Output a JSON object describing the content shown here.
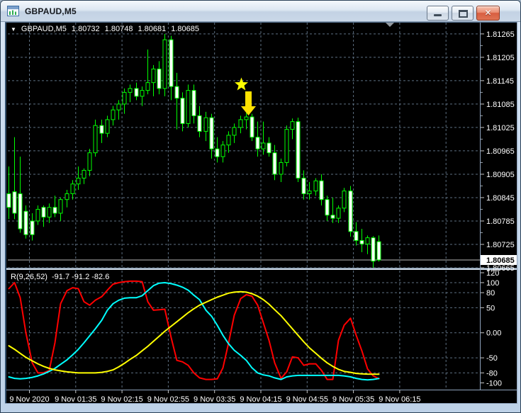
{
  "window": {
    "title": "GBPAUD,M5"
  },
  "icons": {
    "symbol_dropdown": "▼",
    "close": "✕"
  },
  "main_chart": {
    "header": {
      "symbol": "GBPAUD,M5",
      "open": "1.80732",
      "high": "1.80748",
      "low": "1.80681",
      "close": "1.80685"
    }
  },
  "indicator": {
    "label": "R(9,26,52)",
    "current_values": "-91.7 -91.2 -82.6"
  },
  "price_axis": {
    "tick_labels": [
      "1.81265",
      "1.81205",
      "1.81145",
      "1.81085",
      "1.81025",
      "1.80965",
      "1.80905",
      "1.80845",
      "1.80785",
      "1.80725",
      "1.80665"
    ],
    "current_price": "1.80685"
  },
  "time_axis": {
    "labels": [
      "9 Nov 2020",
      "9 Nov 01:35",
      "9 Nov 02:15",
      "9 Nov 02:55",
      "9 Nov 03:35",
      "9 Nov 04:15",
      "9 Nov 04:55",
      "9 Nov 05:35",
      "9 Nov 06:15"
    ]
  },
  "colors": {
    "background": "#000000",
    "grid": "#5e7082",
    "axis_text": "#ffffff",
    "tick": "#c8c8c8",
    "candle_outline": "#00ff00",
    "bull_fill": "#000000",
    "bear_fill": "#ffffff",
    "bid_line": "#b8b8b8",
    "price_tag_bg": "#ffffff",
    "price_tag_text": "#000000",
    "star": "#ffff00",
    "arrow": "#ffe100",
    "shift_marker": "#939aa1",
    "separator": "#c2cedb",
    "frame_dark": "#33516f",
    "frame_light": "#8fa3bc"
  },
  "chart_data": [
    {
      "type": "candlestick",
      "symbol": "GBPAUD",
      "period": "M5",
      "ylim": [
        1.81292,
        1.80665
      ],
      "y_ticks": [
        1.81265,
        1.81205,
        1.81145,
        1.81085,
        1.81025,
        1.80965,
        1.80905,
        1.80845,
        1.80785,
        1.80725,
        1.80665
      ],
      "current_price": 1.80685,
      "marker": {
        "type": "star-and-down-arrow",
        "candle_index": 40,
        "star_price": 1.81135
      },
      "candles": [
        [
          1.80855,
          1.80925,
          1.8079,
          1.8082
        ],
        [
          1.8086,
          1.81,
          1.8079,
          1.80805
        ],
        [
          1.80855,
          1.8095,
          1.80755,
          1.80765
        ],
        [
          1.8081,
          1.80825,
          1.8074,
          1.8075
        ],
        [
          1.80785,
          1.80805,
          1.80735,
          1.8075
        ],
        [
          1.80785,
          1.80825,
          1.80775,
          1.80815
        ],
        [
          1.8082,
          1.80825,
          1.8077,
          1.80795
        ],
        [
          1.80795,
          1.8083,
          1.8078,
          1.8082
        ],
        [
          1.8082,
          1.8085,
          1.80795,
          1.80805
        ],
        [
          1.80805,
          1.80845,
          1.80785,
          1.8084
        ],
        [
          1.8084,
          1.80865,
          1.8082,
          1.80855
        ],
        [
          1.80855,
          1.8089,
          1.8084,
          1.8088
        ],
        [
          1.8088,
          1.80925,
          1.80865,
          1.80895
        ],
        [
          1.80895,
          1.8092,
          1.8088,
          1.80915
        ],
        [
          1.80915,
          1.8097,
          1.809,
          1.8096
        ],
        [
          1.8096,
          1.81045,
          1.8095,
          1.8103
        ],
        [
          1.8103,
          1.81045,
          1.80985,
          1.8101
        ],
        [
          1.8101,
          1.81055,
          1.81,
          1.81045
        ],
        [
          1.81045,
          1.8108,
          1.8103,
          1.8107
        ],
        [
          1.8107,
          1.81095,
          1.81045,
          1.81085
        ],
        [
          1.81085,
          1.81125,
          1.8106,
          1.81115
        ],
        [
          1.81115,
          1.81135,
          1.8109,
          1.81125
        ],
        [
          1.81125,
          1.8114,
          1.81095,
          1.81105
        ],
        [
          1.81105,
          1.8113,
          1.8108,
          1.8112
        ],
        [
          1.8112,
          1.81225,
          1.8111,
          1.8114
        ],
        [
          1.8114,
          1.81185,
          1.81105,
          1.81175
        ],
        [
          1.81175,
          1.81195,
          1.8111,
          1.81125
        ],
        [
          1.81125,
          1.81265,
          1.81105,
          1.8125
        ],
        [
          1.8125,
          1.8126,
          1.81095,
          1.8113
        ],
        [
          1.8113,
          1.81165,
          1.8102,
          1.811
        ],
        [
          1.811,
          1.81115,
          1.81015,
          1.81035
        ],
        [
          1.81035,
          1.81135,
          1.81025,
          1.8112
        ],
        [
          1.8112,
          1.81135,
          1.81035,
          1.81055
        ],
        [
          1.81055,
          1.8108,
          1.81,
          1.81015
        ],
        [
          1.81015,
          1.81065,
          1.8099,
          1.8105
        ],
        [
          1.8105,
          1.8106,
          1.80945,
          1.8097
        ],
        [
          1.8097,
          1.81,
          1.80935,
          1.8095
        ],
        [
          1.8095,
          1.8099,
          1.80935,
          1.8098
        ],
        [
          1.8098,
          1.81015,
          1.8096,
          1.81005
        ],
        [
          1.81005,
          1.81035,
          1.80985,
          1.81025
        ],
        [
          1.81025,
          1.81055,
          1.8101,
          1.81045
        ],
        [
          1.81045,
          1.81062,
          1.8102,
          1.81052
        ],
        [
          1.81052,
          1.8106,
          1.8099,
          1.81
        ],
        [
          1.81,
          1.8104,
          1.8095,
          1.8097
        ],
        [
          1.8097,
          1.8104,
          1.80955,
          1.80985
        ],
        [
          1.80985,
          1.81,
          1.8095,
          1.8096
        ],
        [
          1.8096,
          1.8098,
          1.8089,
          1.80905
        ],
        [
          1.80905,
          1.80945,
          1.80885,
          1.80935
        ],
        [
          1.80935,
          1.8103,
          1.80925,
          1.8102
        ],
        [
          1.8102,
          1.81048,
          1.80995,
          1.8104
        ],
        [
          1.8104,
          1.8105,
          1.80885,
          1.80895
        ],
        [
          1.80895,
          1.80915,
          1.8084,
          1.80855
        ],
        [
          1.80855,
          1.80885,
          1.8084,
          1.80862
        ],
        [
          1.80862,
          1.80895,
          1.8085,
          1.80888
        ],
        [
          1.80888,
          1.80905,
          1.80825,
          1.8084
        ],
        [
          1.8084,
          1.8085,
          1.80785,
          1.808
        ],
        [
          1.808,
          1.80845,
          1.8078,
          1.80792
        ],
        [
          1.80792,
          1.80825,
          1.8078,
          1.80818
        ],
        [
          1.80818,
          1.8087,
          1.80808,
          1.80862
        ],
        [
          1.80862,
          1.80875,
          1.80745,
          1.80758
        ],
        [
          1.80758,
          1.80782,
          1.80722,
          1.80735
        ],
        [
          1.80735,
          1.80765,
          1.80705,
          1.80726
        ],
        [
          1.80726,
          1.80748,
          1.807,
          1.80742
        ],
        [
          1.80742,
          1.80746,
          1.80665,
          1.80682
        ],
        [
          1.80732,
          1.80748,
          1.80681,
          1.80685
        ]
      ]
    },
    {
      "type": "line",
      "name": "R(9,26,52)",
      "ylim": [
        124,
        -112
      ],
      "levels": [
        100,
        80,
        50,
        0,
        -50,
        -80
      ],
      "scale_labels": [
        "120",
        "100",
        "80",
        "50",
        "0.00",
        "-50",
        "-80",
        "-100"
      ],
      "scale_values": [
        120,
        100,
        80,
        50,
        0,
        -50,
        -80,
        -100
      ],
      "series": [
        {
          "name": "R9",
          "color": "#ff0000",
          "values": [
            88,
            100,
            70,
            0,
            -60,
            -80,
            -80,
            -75,
            -20,
            58,
            84,
            90,
            88,
            62,
            55,
            65,
            72,
            85,
            97,
            100,
            102,
            103,
            103,
            102,
            62,
            45,
            46,
            47,
            -10,
            -55,
            -58,
            -65,
            -80,
            -90,
            -93,
            -93,
            -92,
            -70,
            -20,
            35,
            68,
            76,
            73,
            55,
            20,
            -15,
            -60,
            -91,
            -78,
            -48,
            -50,
            -65,
            -62,
            -62,
            -75,
            -93,
            -93,
            -15,
            15,
            29,
            -5,
            -36,
            -72,
            -86,
            -91.7
          ]
        },
        {
          "name": "R26",
          "color": "#00ffff",
          "values": [
            -88,
            -91,
            -92,
            -91,
            -89,
            -86,
            -82,
            -77,
            -71,
            -63,
            -54,
            -44,
            -33,
            -20,
            -6,
            8,
            25,
            45,
            58,
            65,
            69,
            70,
            70,
            74,
            84,
            94,
            99,
            100,
            98,
            95,
            91,
            85,
            75,
            66,
            45,
            33,
            15,
            -5,
            -22,
            -35,
            -45,
            -55,
            -70,
            -80,
            -84,
            -86,
            -90,
            -93,
            -88,
            -86,
            -85,
            -85,
            -85,
            -85,
            -85,
            -85,
            -85,
            -85,
            -86,
            -88,
            -91,
            -93,
            -94,
            -93,
            -91.2
          ]
        },
        {
          "name": "R52",
          "color": "#ffff00",
          "values": [
            -26,
            -33,
            -41,
            -49,
            -56,
            -62,
            -67,
            -71,
            -74,
            -76,
            -78,
            -79,
            -80,
            -80,
            -80,
            -80,
            -79,
            -77,
            -74,
            -68,
            -61,
            -53,
            -45,
            -36,
            -27,
            -17,
            -7,
            3,
            13,
            22,
            31,
            40,
            48,
            55,
            61,
            66,
            71,
            75,
            79,
            81,
            82,
            81,
            78,
            73,
            66,
            57,
            46,
            34,
            21,
            8,
            -5,
            -18,
            -30,
            -41,
            -51,
            -60,
            -67,
            -73,
            -77,
            -79,
            -81,
            -82,
            -82.5,
            -82.6,
            -82.6
          ]
        }
      ]
    }
  ]
}
